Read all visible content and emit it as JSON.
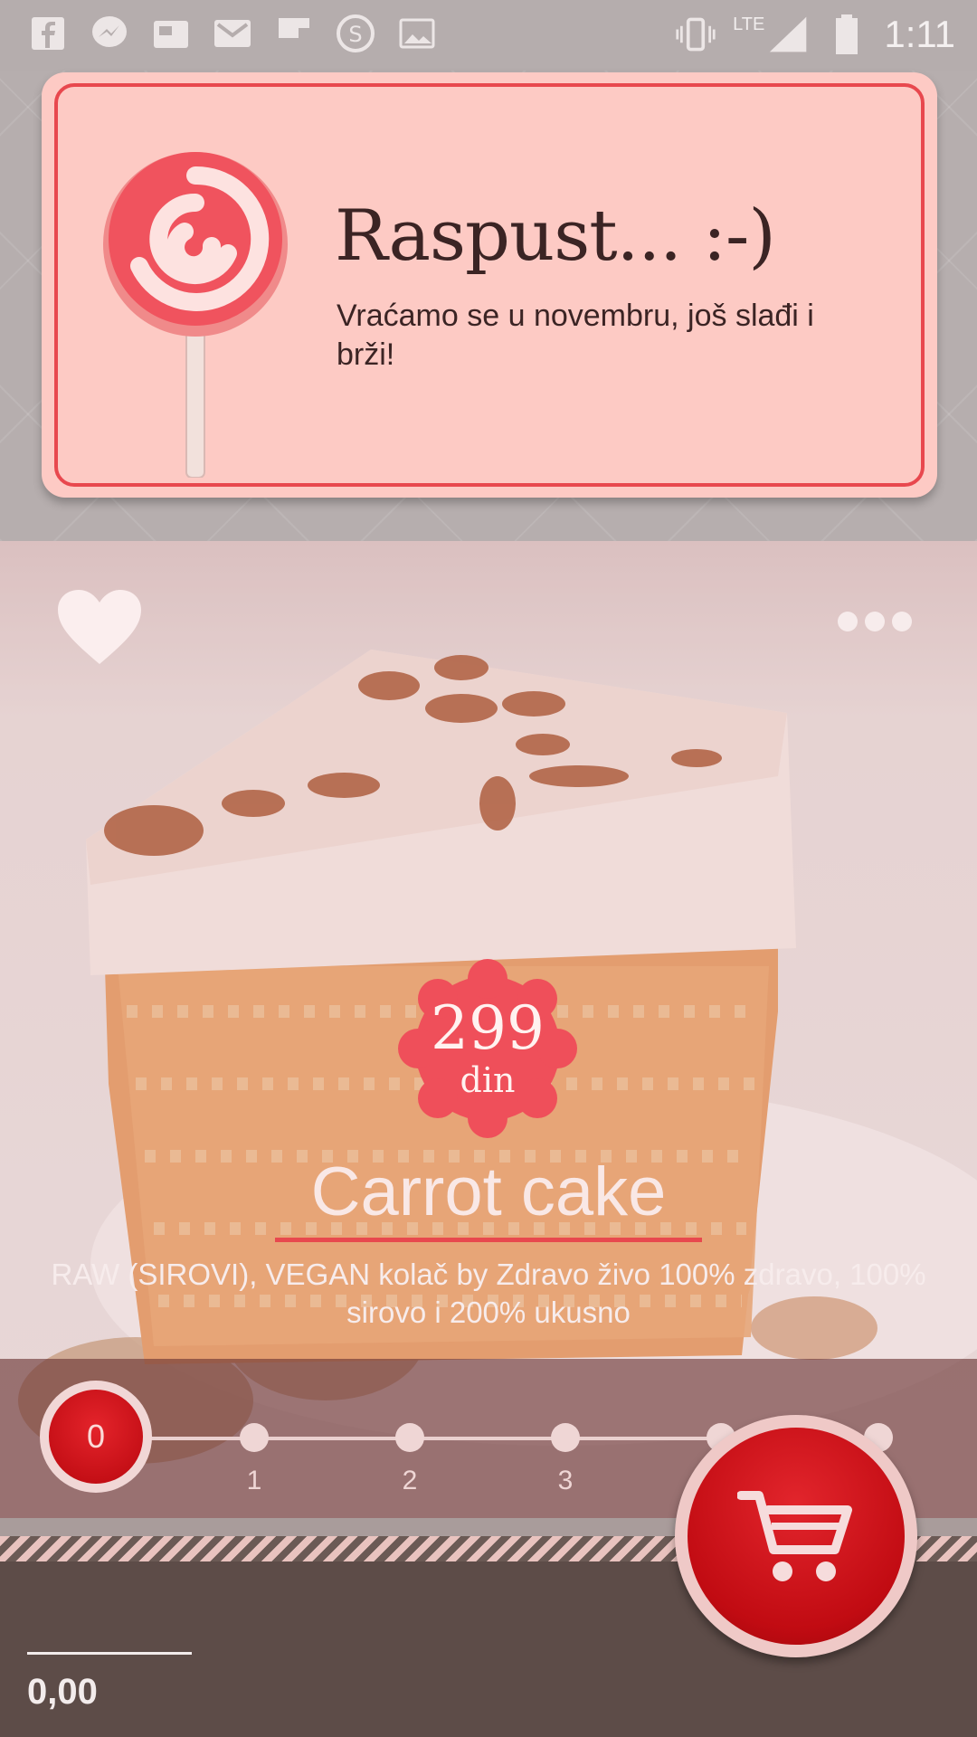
{
  "status_bar": {
    "time": "1:11",
    "network": "LTE",
    "left_icons": [
      "facebook-icon",
      "messenger-icon",
      "image-icon",
      "gmail-icon",
      "flipboard-icon",
      "chat-icon",
      "gallery-icon"
    ],
    "right_icons": [
      "vibrate-icon",
      "signal-icon",
      "battery-icon"
    ]
  },
  "notice": {
    "title": "Raspust... :-)",
    "message": "Vraćamo se u novembru, još slađi i brži!"
  },
  "product": {
    "price": "299",
    "currency": "din",
    "name": "Carrot cake",
    "description": "RAW (SIROVI), VEGAN kolač by Zdravo živo 100% zdravo, 100% sirovo i 200% ukusno"
  },
  "quantity": {
    "current": "0",
    "steps": [
      "1",
      "2",
      "3"
    ]
  },
  "footer": {
    "total": "0,00"
  },
  "colors": {
    "accent_red": "#e8484e",
    "cart_red": "#c10b12",
    "card_pink": "#fdcac4",
    "footer_brown": "#5d4c48"
  }
}
